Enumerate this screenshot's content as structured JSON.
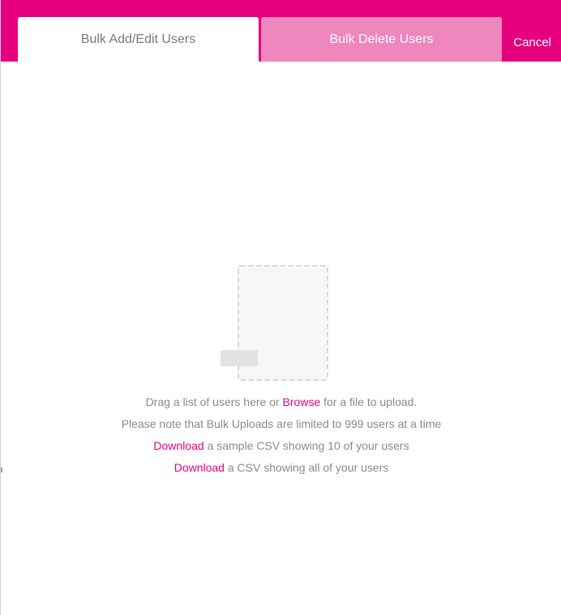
{
  "tabs": {
    "add_edit_label": "Bulk Add/Edit Users",
    "delete_label": "Bulk Delete Users"
  },
  "header": {
    "cancel_label": "Cancel"
  },
  "upload": {
    "drag_prefix": "Drag a list of users here or",
    "browse_link": "Browse",
    "drag_suffix": "for a file to upload.",
    "limit_note": "Please note that Bulk Uploads are limited to 999 users at a time",
    "sample_link": "Download",
    "sample_text": "a sample CSV showing 10 of your users",
    "all_link": "Download",
    "all_text": "a CSV showing all of your users"
  },
  "colors": {
    "brand": "#e6007e",
    "tab_inactive": "#ef86bd",
    "text_muted": "#8a8a8a"
  },
  "icons": {
    "dropzone": "file-drop-icon"
  }
}
